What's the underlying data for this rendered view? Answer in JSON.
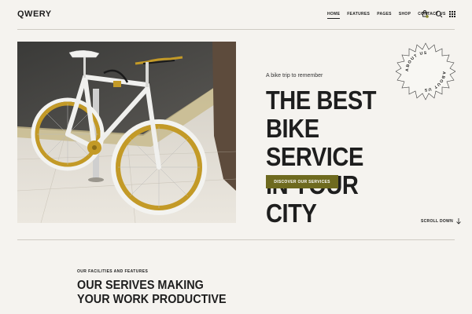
{
  "brand": {
    "logo": "QWERY"
  },
  "nav": {
    "items": [
      {
        "label": "HOME",
        "active": true
      },
      {
        "label": "FEATURES",
        "active": false
      },
      {
        "label": "PAGES",
        "active": false
      },
      {
        "label": "SHOP",
        "active": false
      },
      {
        "label": "CONTACT US",
        "active": false
      }
    ],
    "icons": [
      "cart-icon",
      "search-icon",
      "grid-menu-icon"
    ]
  },
  "hero": {
    "tagline": "A bike trip to remember",
    "title_lines": [
      "THE BEST",
      "BIKE SERVICE",
      "IN YOUR CITY"
    ],
    "cta_label": "DISCOVER OUR SERVICES",
    "badge_text": "ABOUT US",
    "scroll_label": "SCROLL DOWN",
    "image": "white bicycle with gold rims leaning on street pole"
  },
  "section": {
    "eyebrow": "OUR FACILITIES AND FEATURES",
    "title": "OUR SERIVES MAKING YOUR WORK PRODUCTIVE"
  },
  "colors": {
    "accent": "#6e6a1f",
    "background": "#f5f3ef",
    "text": "#1e1e1e"
  }
}
